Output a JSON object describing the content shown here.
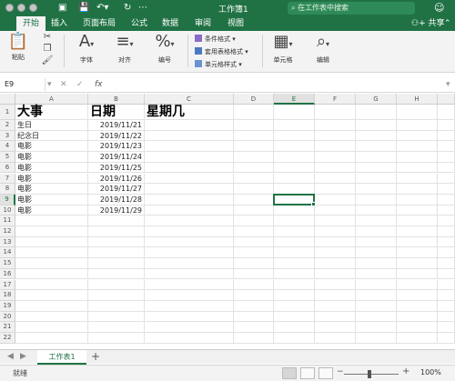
{
  "window": {
    "title": "工作簿1"
  },
  "search": {
    "placeholder": "在工作表中搜索"
  },
  "tabs": [
    "开始",
    "插入",
    "页面布局",
    "公式",
    "数据",
    "审阅",
    "视图"
  ],
  "share_label": "共享",
  "ribbon": {
    "paste": "粘贴",
    "font": "字体",
    "align": "对齐",
    "number": "编号",
    "cond_format": "条件格式",
    "table_format": "套用表格格式",
    "cell_style": "单元格样式",
    "cells": "单元格",
    "edit": "编辑"
  },
  "formula_bar": {
    "name_box": "E9",
    "fx": "fx",
    "value": ""
  },
  "columns": [
    "A",
    "B",
    "C",
    "D",
    "E",
    "F",
    "G",
    "H"
  ],
  "selected_column": "E",
  "selected_row": 9,
  "rows": [
    {
      "n": "1",
      "a": "大事",
      "b": "日期",
      "c": "星期几"
    },
    {
      "n": "2",
      "a": "生日",
      "b": "2019/11/21",
      "c": ""
    },
    {
      "n": "3",
      "a": "纪念日",
      "b": "2019/11/22",
      "c": ""
    },
    {
      "n": "4",
      "a": "电影",
      "b": "2019/11/23",
      "c": ""
    },
    {
      "n": "5",
      "a": "电影",
      "b": "2019/11/24",
      "c": ""
    },
    {
      "n": "6",
      "a": "电影",
      "b": "2019/11/25",
      "c": ""
    },
    {
      "n": "7",
      "a": "电影",
      "b": "2019/11/26",
      "c": ""
    },
    {
      "n": "8",
      "a": "电影",
      "b": "2019/11/27",
      "c": ""
    },
    {
      "n": "9",
      "a": "电影",
      "b": "2019/11/28",
      "c": ""
    },
    {
      "n": "10",
      "a": "电影",
      "b": "2019/11/29",
      "c": ""
    },
    {
      "n": "11",
      "a": "",
      "b": "",
      "c": ""
    },
    {
      "n": "12",
      "a": "",
      "b": "",
      "c": ""
    },
    {
      "n": "13",
      "a": "",
      "b": "",
      "c": ""
    },
    {
      "n": "14",
      "a": "",
      "b": "",
      "c": ""
    },
    {
      "n": "15",
      "a": "",
      "b": "",
      "c": ""
    },
    {
      "n": "16",
      "a": "",
      "b": "",
      "c": ""
    },
    {
      "n": "17",
      "a": "",
      "b": "",
      "c": ""
    },
    {
      "n": "18",
      "a": "",
      "b": "",
      "c": ""
    },
    {
      "n": "19",
      "a": "",
      "b": "",
      "c": ""
    },
    {
      "n": "20",
      "a": "",
      "b": "",
      "c": ""
    },
    {
      "n": "21",
      "a": "",
      "b": "",
      "c": ""
    },
    {
      "n": "22",
      "a": "",
      "b": "",
      "c": ""
    }
  ],
  "sheet_tab": "工作表1",
  "status": {
    "text": "就绪",
    "zoom": "100%"
  },
  "colors": {
    "accent": "#207245"
  }
}
